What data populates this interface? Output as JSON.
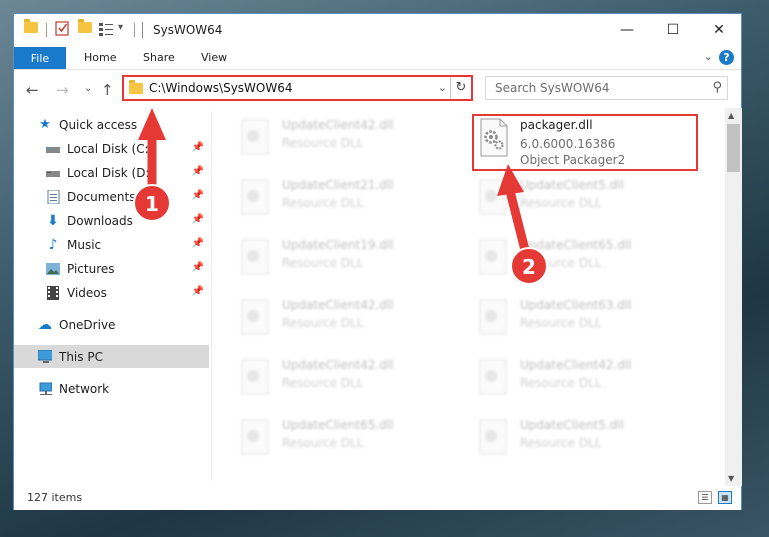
{
  "window": {
    "title": "SysWOW64",
    "controls": {
      "minimize": "—",
      "maximize": "☐",
      "close": "✕"
    }
  },
  "ribbon": {
    "tabs": [
      "File",
      "Home",
      "Share",
      "View"
    ]
  },
  "navigation": {
    "address": "C:\\Windows\\SysWOW64",
    "search_placeholder": "Search SysWOW64"
  },
  "sidebar": {
    "items": [
      {
        "label": "Quick access",
        "icon": "star-icon",
        "pinned": false,
        "selected": false
      },
      {
        "label": "Local Disk (C:)",
        "icon": "drive-icon",
        "pinned": true,
        "selected": false
      },
      {
        "label": "Local Disk (D:)",
        "icon": "drive-icon",
        "pinned": true,
        "selected": false
      },
      {
        "label": "Documents",
        "icon": "documents-icon",
        "pinned": true,
        "selected": false
      },
      {
        "label": "Downloads",
        "icon": "download-icon",
        "pinned": true,
        "selected": false
      },
      {
        "label": "Music",
        "icon": "music-icon",
        "pinned": true,
        "selected": false
      },
      {
        "label": "Pictures",
        "icon": "pictures-icon",
        "pinned": true,
        "selected": false
      },
      {
        "label": "Videos",
        "icon": "videos-icon",
        "pinned": true,
        "selected": false
      },
      {
        "label": "OneDrive",
        "icon": "cloud-icon",
        "pinned": false,
        "selected": false
      },
      {
        "label": "This PC",
        "icon": "computer-icon",
        "pinned": false,
        "selected": true
      },
      {
        "label": "Network",
        "icon": "network-icon",
        "pinned": false,
        "selected": false
      }
    ]
  },
  "files": {
    "featured": {
      "name": "packager.dll",
      "version": "6.0.6000.16386",
      "description": "Object Packager2"
    },
    "left_column": [
      {
        "name": "UpdateClient42.dll",
        "description": "Resource DLL"
      },
      {
        "name": "UpdateClient21.dll",
        "description": "Resource DLL"
      },
      {
        "name": "UpdateClient19.dll",
        "description": "Resource DLL"
      },
      {
        "name": "UpdateClient42.dll",
        "description": "Resource DLL"
      },
      {
        "name": "UpdateClient42.dll",
        "description": "Resource DLL"
      },
      {
        "name": "UpdateClient65.dll",
        "description": "Resource DLL"
      }
    ],
    "right_column": [
      {
        "name": "UpdateClient5.dll",
        "description": "Resource DLL"
      },
      {
        "name": "UpdateClient65.dll",
        "description": "Resource DLL"
      },
      {
        "name": "UpdateClient63.dll",
        "description": "Resource DLL"
      },
      {
        "name": "UpdateClient42.dll",
        "description": "Resource DLL"
      },
      {
        "name": "UpdateClient5.dll",
        "description": "Resource DLL"
      }
    ]
  },
  "status": {
    "item_count": "127 items"
  },
  "annotations": [
    {
      "number": "1",
      "color": "#e53935"
    },
    {
      "number": "2",
      "color": "#e53935"
    }
  ],
  "colors": {
    "accent": "#1979ca",
    "annotation": "#e53935",
    "selected_bg": "#d9d9d9"
  }
}
